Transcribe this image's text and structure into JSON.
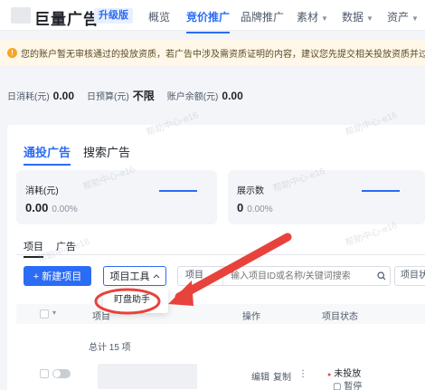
{
  "header": {
    "brand": "巨量广告",
    "badge": "升级版",
    "nav": [
      {
        "label": "概览",
        "has_caret": false,
        "active": false
      },
      {
        "label": "竞价推广",
        "has_caret": false,
        "active": true
      },
      {
        "label": "品牌推广",
        "has_caret": false,
        "active": false
      },
      {
        "label": "素材",
        "has_caret": true,
        "active": false
      },
      {
        "label": "数据",
        "has_caret": true,
        "active": false
      },
      {
        "label": "资产",
        "has_caret": true,
        "active": false
      }
    ]
  },
  "warning": {
    "icon": "warning-icon",
    "text": "您的账户暂无审核通过的投放资质，若广告中涉及需资质证明的内容，建议您先提交相关投放资质并过审后再提交广告审核"
  },
  "stats": [
    {
      "label": "日消耗(元)",
      "value": "0.00"
    },
    {
      "label": "日预算(元)",
      "value": "不限"
    },
    {
      "label": "账户余额(元)",
      "value": "0.00"
    }
  ],
  "main_tabs": [
    {
      "label": "通投广告",
      "active": true
    },
    {
      "label": "搜索广告",
      "active": false
    }
  ],
  "metrics": [
    {
      "label": "消耗(元)",
      "value": "0.00",
      "pct": "0.00%"
    },
    {
      "label": "展示数",
      "value": "0",
      "pct": "0.00%"
    }
  ],
  "sub_tabs": [
    {
      "label": "项目",
      "active": true
    },
    {
      "label": "广告",
      "active": false
    }
  ],
  "toolbar": {
    "new_project": "+ 新建项目",
    "project_tools": "项目工具",
    "search_type": "项目",
    "search_placeholder": "输入项目ID或名称/关键词搜索",
    "status_filter": "项目状"
  },
  "dropdown": {
    "items": [
      "盯盘助手"
    ]
  },
  "table": {
    "columns": [
      "项目",
      "操作",
      "项目状态"
    ],
    "total": "总计 15 项",
    "rows": [
      {
        "actions": [
          "编辑",
          "复制",
          "⋮"
        ],
        "status": "未投放",
        "status_sub": "暂停"
      }
    ]
  },
  "watermark": "帮助中心-e16",
  "colors": {
    "accent": "#2b6cf5",
    "annotation": "#e8423c",
    "warning_bg": "#fff7e8"
  }
}
